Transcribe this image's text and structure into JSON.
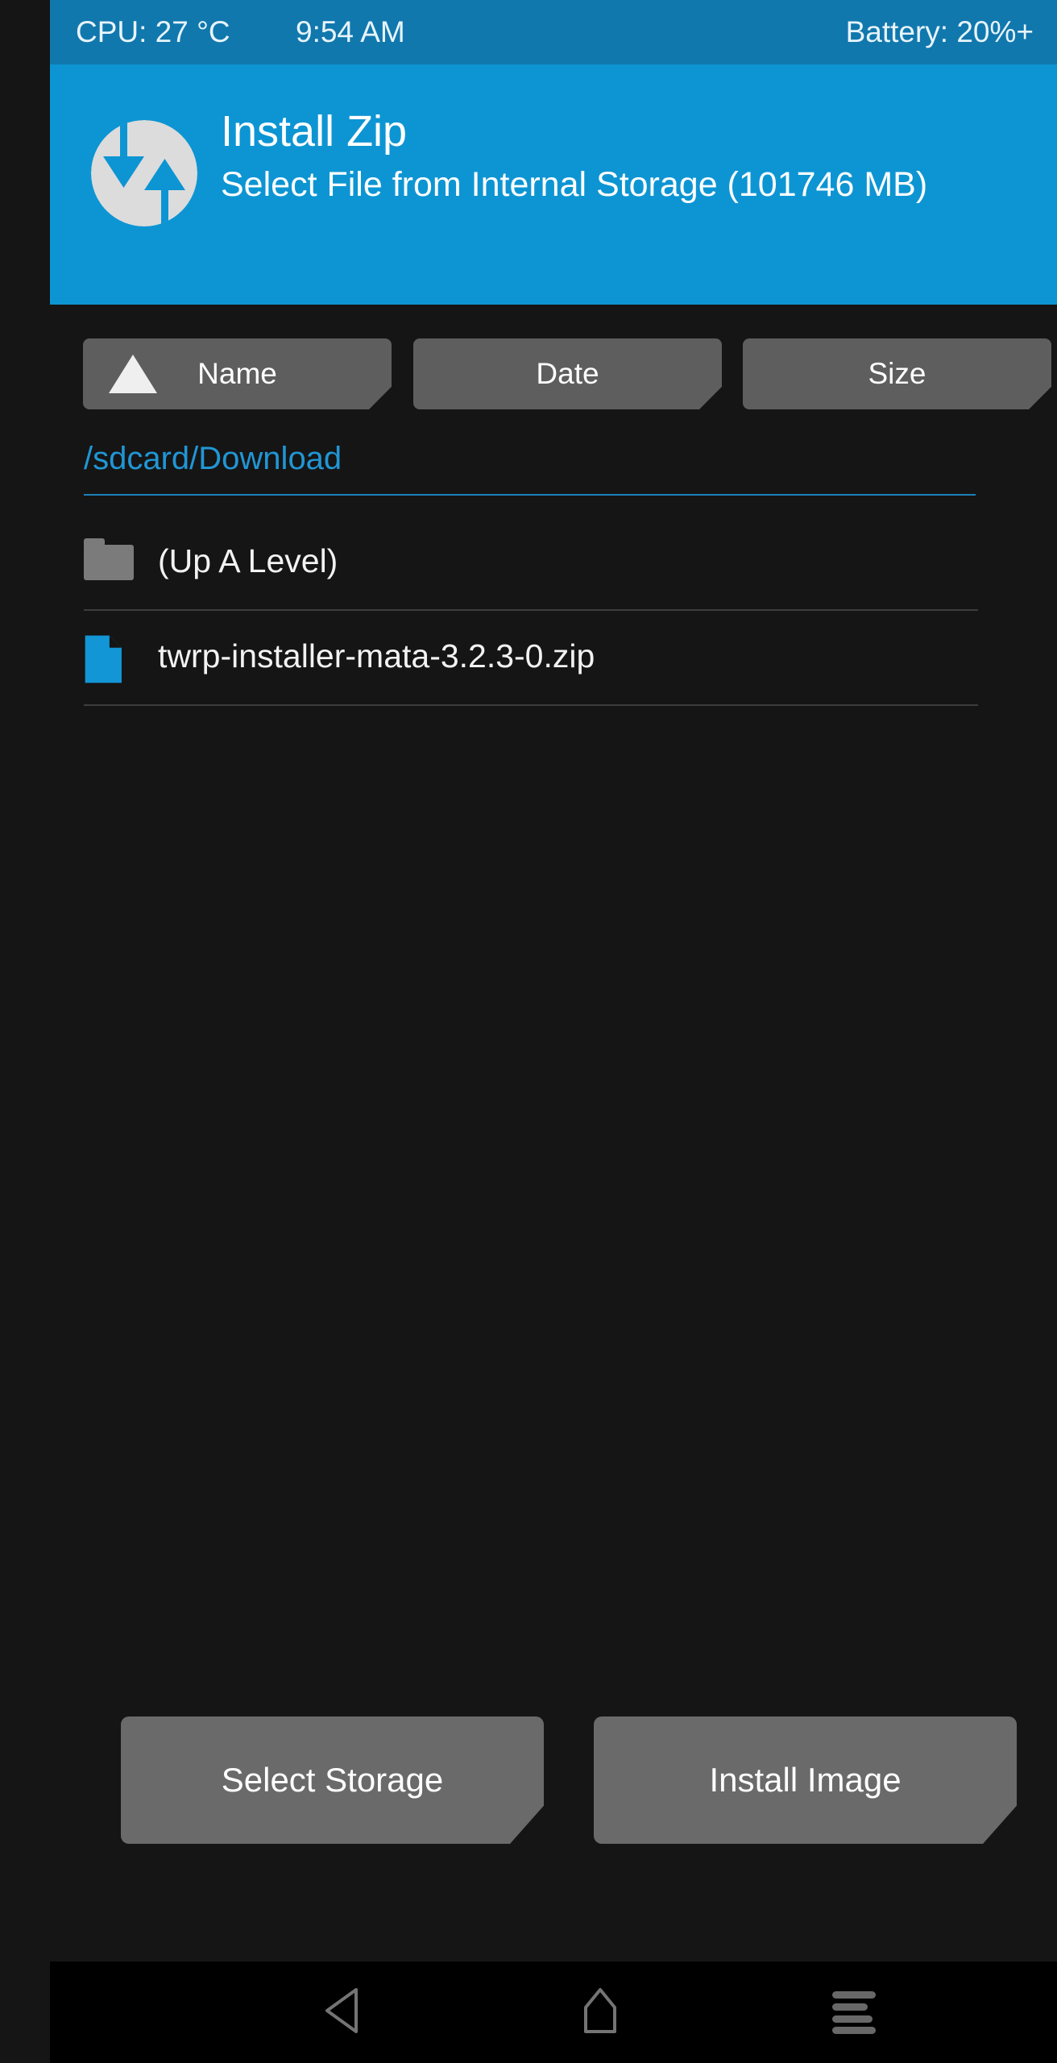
{
  "status_bar": {
    "cpu": "CPU: 27 °C",
    "time": "9:54 AM",
    "battery": "Battery: 20%+"
  },
  "header": {
    "logo_icon": "twrp-logo-icon",
    "title": "Install Zip",
    "subtitle": "Select File from Internal Storage (101746 MB)"
  },
  "sort_buttons": [
    {
      "label": "Name",
      "active": true,
      "arrow_icon": "sort-ascending-triangle-icon"
    },
    {
      "label": "Date",
      "active": false,
      "arrow_icon": ""
    },
    {
      "label": "Size",
      "active": false,
      "arrow_icon": ""
    }
  ],
  "path": {
    "current": "/sdcard/Download"
  },
  "files": [
    {
      "name": "(Up A Level)",
      "icon": "folder-icon",
      "type": "folder"
    },
    {
      "name": "twrp-installer-mata-3.2.3-0.zip",
      "icon": "zip-file-icon",
      "type": "file"
    }
  ],
  "actions": [
    {
      "label": "Select Storage"
    },
    {
      "label": "Install Image"
    }
  ],
  "navigation": [
    {
      "icon": "back-icon"
    },
    {
      "icon": "home-icon"
    },
    {
      "icon": "menu-icon"
    }
  ],
  "colors": {
    "status_bar_blue": "#1178ad",
    "header_blue": "#0d95d3",
    "accent_blue": "#2196d4",
    "file_icon_blue": "#1296d6",
    "button_gray": "#5e5e5e",
    "action_button_gray": "#6a6a6a",
    "background_dark": "#151515"
  }
}
